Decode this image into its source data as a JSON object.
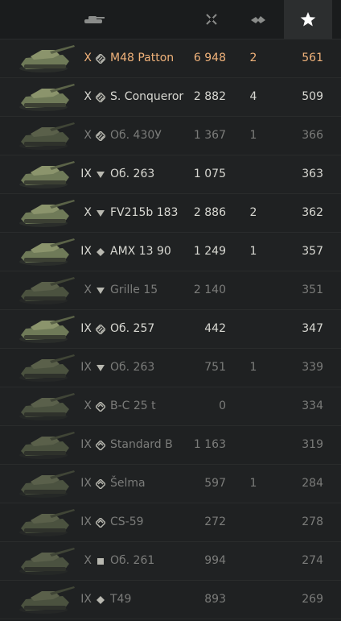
{
  "header": {
    "tank_col_icon": "tank-icon",
    "battles_col_icon": "crossed-swords-icon",
    "kills_col_icon": "destroyed-tank-icon",
    "rating_col_icon": "star-icon"
  },
  "rows": [
    {
      "tier": "X",
      "class": "heavy",
      "name": "M48 Patton",
      "battles": "6 948",
      "kills": "2",
      "rating": "561",
      "style": "gold"
    },
    {
      "tier": "X",
      "class": "heavy",
      "name": "S. Conqueror",
      "battles": "2 882",
      "kills": "4",
      "rating": "509",
      "style": "normal"
    },
    {
      "tier": "X",
      "class": "heavy",
      "name": "Об. 430У",
      "battles": "1 367",
      "kills": "1",
      "rating": "366",
      "style": "dim"
    },
    {
      "tier": "IX",
      "class": "td",
      "name": "Об. 263",
      "battles": "1 075",
      "kills": "",
      "rating": "363",
      "style": "normal"
    },
    {
      "tier": "X",
      "class": "td",
      "name": "FV215b 183",
      "battles": "2 886",
      "kills": "2",
      "rating": "362",
      "style": "normal"
    },
    {
      "tier": "IX",
      "class": "light",
      "name": "AMX 13 90",
      "battles": "1 249",
      "kills": "1",
      "rating": "357",
      "style": "normal"
    },
    {
      "tier": "X",
      "class": "td",
      "name": "Grille 15",
      "battles": "2 140",
      "kills": "",
      "rating": "351",
      "style": "dim"
    },
    {
      "tier": "IX",
      "class": "heavy",
      "name": "Об. 257",
      "battles": "442",
      "kills": "",
      "rating": "347",
      "style": "normal"
    },
    {
      "tier": "IX",
      "class": "td",
      "name": "Об. 263",
      "battles": "751",
      "kills": "1",
      "rating": "339",
      "style": "dim"
    },
    {
      "tier": "X",
      "class": "medium",
      "name": "B-C 25 t",
      "battles": "0",
      "kills": "",
      "rating": "334",
      "style": "dim"
    },
    {
      "tier": "IX",
      "class": "medium",
      "name": "Standard B",
      "battles": "1 163",
      "kills": "",
      "rating": "319",
      "style": "dim"
    },
    {
      "tier": "IX",
      "class": "medium",
      "name": "Šelma",
      "battles": "597",
      "kills": "1",
      "rating": "284",
      "style": "dim"
    },
    {
      "tier": "IX",
      "class": "medium",
      "name": "CS-59",
      "battles": "272",
      "kills": "",
      "rating": "278",
      "style": "dim"
    },
    {
      "tier": "X",
      "class": "spg",
      "name": "Об. 261",
      "battles": "994",
      "kills": "",
      "rating": "274",
      "style": "dim"
    },
    {
      "tier": "IX",
      "class": "light",
      "name": "T49",
      "battles": "893",
      "kills": "",
      "rating": "269",
      "style": "dim"
    }
  ],
  "colors": {
    "background": "#1c1e1f",
    "gold_text": "#f0b27a",
    "dim_text": "#7b7c7a",
    "normal_text": "#d8d8d2"
  }
}
